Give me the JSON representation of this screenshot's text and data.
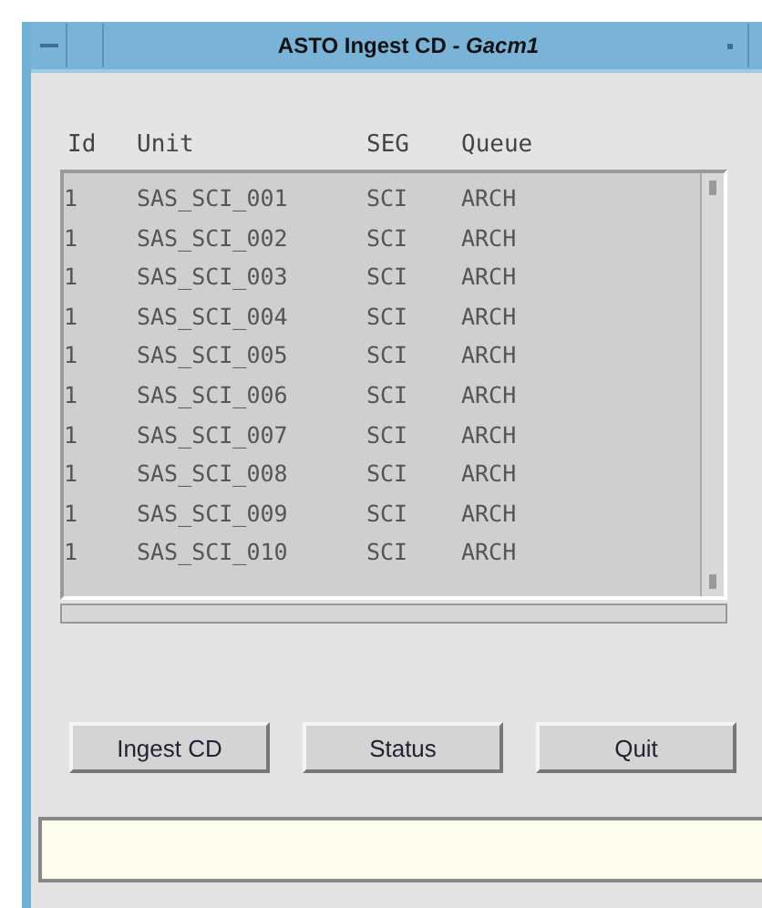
{
  "window": {
    "title": "ASTO Ingest CD - *Gacm1*"
  },
  "table": {
    "columns": [
      "Id",
      "Unit",
      "SEG",
      "Queue"
    ],
    "rows": [
      [
        "1",
        "SAS_SCI_001",
        "SCI",
        "ARCH"
      ],
      [
        "1",
        "SAS_SCI_002",
        "SCI",
        "ARCH"
      ],
      [
        "1",
        "SAS_SCI_003",
        "SCI",
        "ARCH"
      ],
      [
        "1",
        "SAS_SCI_004",
        "SCI",
        "ARCH"
      ],
      [
        "1",
        "SAS_SCI_005",
        "SCI",
        "ARCH"
      ],
      [
        "1",
        "SAS_SCI_006",
        "SCI",
        "ARCH"
      ],
      [
        "1",
        "SAS_SCI_007",
        "SCI",
        "ARCH"
      ],
      [
        "1",
        "SAS_SCI_008",
        "SCI",
        "ARCH"
      ],
      [
        "1",
        "SAS_SCI_009",
        "SCI",
        "ARCH"
      ],
      [
        "1",
        "SAS_SCI_010",
        "SCI",
        "ARCH"
      ]
    ]
  },
  "buttons": [
    "Ingest CD",
    "Status",
    "Quit"
  ]
}
